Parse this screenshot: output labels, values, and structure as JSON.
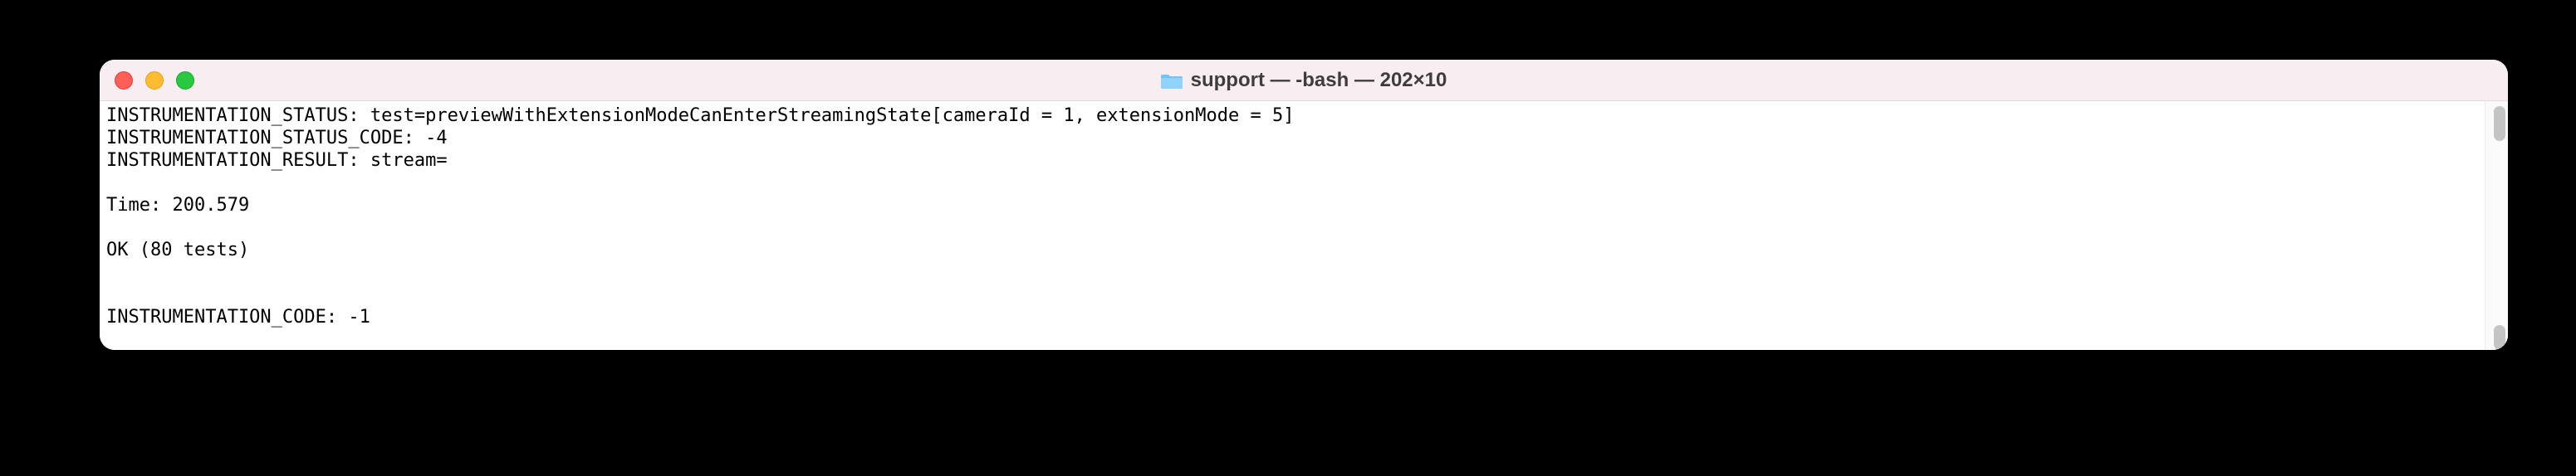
{
  "window": {
    "title": "support — -bash — 202×10"
  },
  "terminal": {
    "lines": {
      "l0": "INSTRUMENTATION_STATUS: test=previewWithExtensionModeCanEnterStreamingState[cameraId = 1, extensionMode = 5]",
      "l1": "INSTRUMENTATION_STATUS_CODE: -4",
      "l2": "INSTRUMENTATION_RESULT: stream=",
      "l3": "",
      "l4": "Time: 200.579",
      "l5": "",
      "l6": "OK (80 tests)",
      "l7": "",
      "l8": "",
      "l9": "INSTRUMENTATION_CODE: -1"
    }
  },
  "scrollbar": {
    "thumb_top_pct": 2,
    "thumb_height_pct": 14,
    "thumb2_top_pct": 90,
    "thumb2_height_pct": 10
  }
}
